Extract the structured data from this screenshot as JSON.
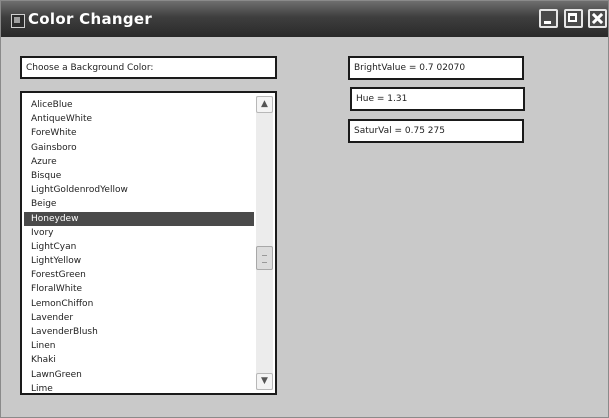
{
  "window": {
    "title": "Color Changer"
  },
  "labels": {
    "choose": "Choose a Background Color:",
    "brightness": "BrightValue = 0.7 02070",
    "hue": "Hue = 1.31",
    "saturation": "SaturVal = 0.75 275"
  },
  "colors": {
    "selected_row_bg": "#4a4a4a",
    "window_bg": "#c9c9c9",
    "titlebar": "#3e3e3e"
  },
  "listbox": {
    "selected_index": 8,
    "items": [
      "AliceBlue",
      "AntiqueWhite",
      "ForeWhite",
      "Gainsboro",
      "Azure",
      "Bisque",
      "LightGoldenrodYellow",
      "Beige",
      "Honeydew",
      "Ivory",
      "LightCyan",
      "LightYellow",
      "ForestGreen",
      "FloralWhite",
      "LemonChiffon",
      "Lavender",
      "LavenderBlush",
      "Linen",
      "Khaki",
      "LawnGreen",
      "Lime"
    ]
  }
}
